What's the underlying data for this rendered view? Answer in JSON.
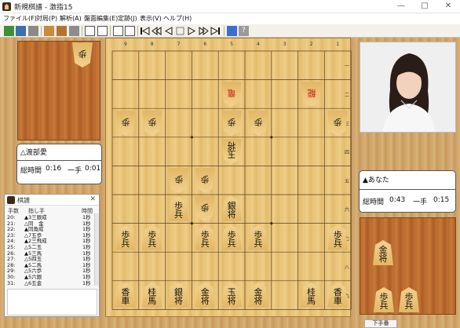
{
  "window": {
    "title": "新規棋譜 - 激指15",
    "controls": {
      "minimize": "—",
      "maximize": "□",
      "close": "✕"
    }
  },
  "menu": [
    {
      "label": "ファイル(F)"
    },
    {
      "label": "対局(P)"
    },
    {
      "label": "解析(A)"
    },
    {
      "label": "盤面編集(E)"
    },
    {
      "label": "定跡(J)"
    },
    {
      "label": "表示(V)"
    },
    {
      "label": "ヘルプ(H)"
    }
  ],
  "toolbar": {
    "icons": [
      "open-file-icon",
      "save-file-icon",
      "print-icon",
      "board-icon",
      "board-alt-icon",
      "gray-square-icon",
      "book-icon",
      "book-alt-icon",
      "board-grid-icon",
      "board-grid-alt-icon",
      "first-move-icon",
      "back-ten-icon",
      "back-one-icon",
      "pause-icon",
      "forward-one-icon",
      "forward-ten-icon",
      "last-move-icon",
      "blue-square-icon",
      "help-icon"
    ]
  },
  "board": {
    "files": [
      "9",
      "8",
      "7",
      "6",
      "5",
      "4",
      "3",
      "2",
      "1"
    ],
    "ranks": [
      "一",
      "二",
      "三",
      "四",
      "五",
      "六",
      "七",
      "八",
      "九"
    ],
    "pieces": [
      {
        "file": 5,
        "rank": 2,
        "char": "竜",
        "owner": "gote",
        "red": true
      },
      {
        "file": 2,
        "rank": 2,
        "char": "龍",
        "owner": "gote",
        "red": true
      },
      {
        "file": 9,
        "rank": 3,
        "char": "歩",
        "owner": "gote"
      },
      {
        "file": 8,
        "rank": 3,
        "char": "歩",
        "owner": "gote"
      },
      {
        "file": 5,
        "rank": 3,
        "char": "歩",
        "owner": "gote"
      },
      {
        "file": 4,
        "rank": 3,
        "char": "歩",
        "owner": "gote"
      },
      {
        "file": 1,
        "rank": 3,
        "char": "歩",
        "owner": "gote"
      },
      {
        "file": 5,
        "rank": 4,
        "char": "玉将",
        "owner": "gote"
      },
      {
        "file": 7,
        "rank": 5,
        "char": "歩",
        "owner": "gote"
      },
      {
        "file": 6,
        "rank": 5,
        "char": "歩",
        "owner": "gote"
      },
      {
        "file": 7,
        "rank": 6,
        "char": "歩兵",
        "owner": "sente"
      },
      {
        "file": 6,
        "rank": 6,
        "char": "歩",
        "owner": "gote"
      },
      {
        "file": 5,
        "rank": 6,
        "char": "銀将",
        "owner": "sente"
      },
      {
        "file": 9,
        "rank": 7,
        "char": "歩兵",
        "owner": "sente"
      },
      {
        "file": 8,
        "rank": 7,
        "char": "歩兵",
        "owner": "sente"
      },
      {
        "file": 6,
        "rank": 7,
        "char": "歩兵",
        "owner": "sente"
      },
      {
        "file": 5,
        "rank": 7,
        "char": "歩兵",
        "owner": "sente"
      },
      {
        "file": 4,
        "rank": 7,
        "char": "歩兵",
        "owner": "sente"
      },
      {
        "file": 1,
        "rank": 7,
        "char": "歩兵",
        "owner": "sente"
      },
      {
        "file": 9,
        "rank": 9,
        "char": "香車",
        "owner": "sente"
      },
      {
        "file": 8,
        "rank": 9,
        "char": "桂馬",
        "owner": "sente"
      },
      {
        "file": 7,
        "rank": 9,
        "char": "銀将",
        "owner": "sente"
      },
      {
        "file": 6,
        "rank": 9,
        "char": "金将",
        "owner": "sente"
      },
      {
        "file": 5,
        "rank": 9,
        "char": "玉将",
        "owner": "sente"
      },
      {
        "file": 4,
        "rank": 9,
        "char": "金将",
        "owner": "sente"
      },
      {
        "file": 2,
        "rank": 9,
        "char": "桂馬",
        "owner": "sente"
      },
      {
        "file": 1,
        "rank": 9,
        "char": "香車",
        "owner": "sente"
      }
    ]
  },
  "gote_hand": [
    {
      "char": "歩"
    }
  ],
  "sente_hand": [
    {
      "char": "金将"
    },
    {
      "char": "歩兵"
    },
    {
      "char": "歩兵"
    }
  ],
  "gote_player": {
    "name": "△渡部愛",
    "time_label": "総時間",
    "time_total": "0:16",
    "time_sep": "一手",
    "time_move": "0:01"
  },
  "sente_player": {
    "name": "▲あなた",
    "time_label": "総時間",
    "time_total": "0:43",
    "time_sep": "一手",
    "time_move": "0:15"
  },
  "kifu": {
    "title": "棋譜",
    "close": "✕",
    "headers": {
      "num": "手数",
      "move": "指し手",
      "time": "時間"
    },
    "rows": [
      {
        "num": "20:",
        "move": "▲3三銀成",
        "time": "1秒"
      },
      {
        "num": "21:",
        "move": "△同　金",
        "time": "1秒"
      },
      {
        "num": "22:",
        "move": "▲同角成",
        "time": "1秒"
      },
      {
        "num": "23:",
        "move": "△7五歩",
        "time": "1秒"
      },
      {
        "num": "24:",
        "move": "▲2三飛成",
        "time": "1秒"
      },
      {
        "num": "25:",
        "move": "△5二玉",
        "time": "1秒"
      },
      {
        "num": "26:",
        "move": "▲5三馬",
        "time": "1秒"
      },
      {
        "num": "27:",
        "move": "△5四玉",
        "time": "1秒"
      },
      {
        "num": "28:",
        "move": "▲5二馬",
        "time": "1秒"
      },
      {
        "num": "29:",
        "move": "△5六歩",
        "time": "1秒"
      },
      {
        "num": "30:",
        "move": "▲5六銀",
        "time": "1秒"
      },
      {
        "num": "31:",
        "move": "△6五金",
        "time": "1秒"
      }
    ]
  },
  "status": {
    "button": "下手番"
  }
}
